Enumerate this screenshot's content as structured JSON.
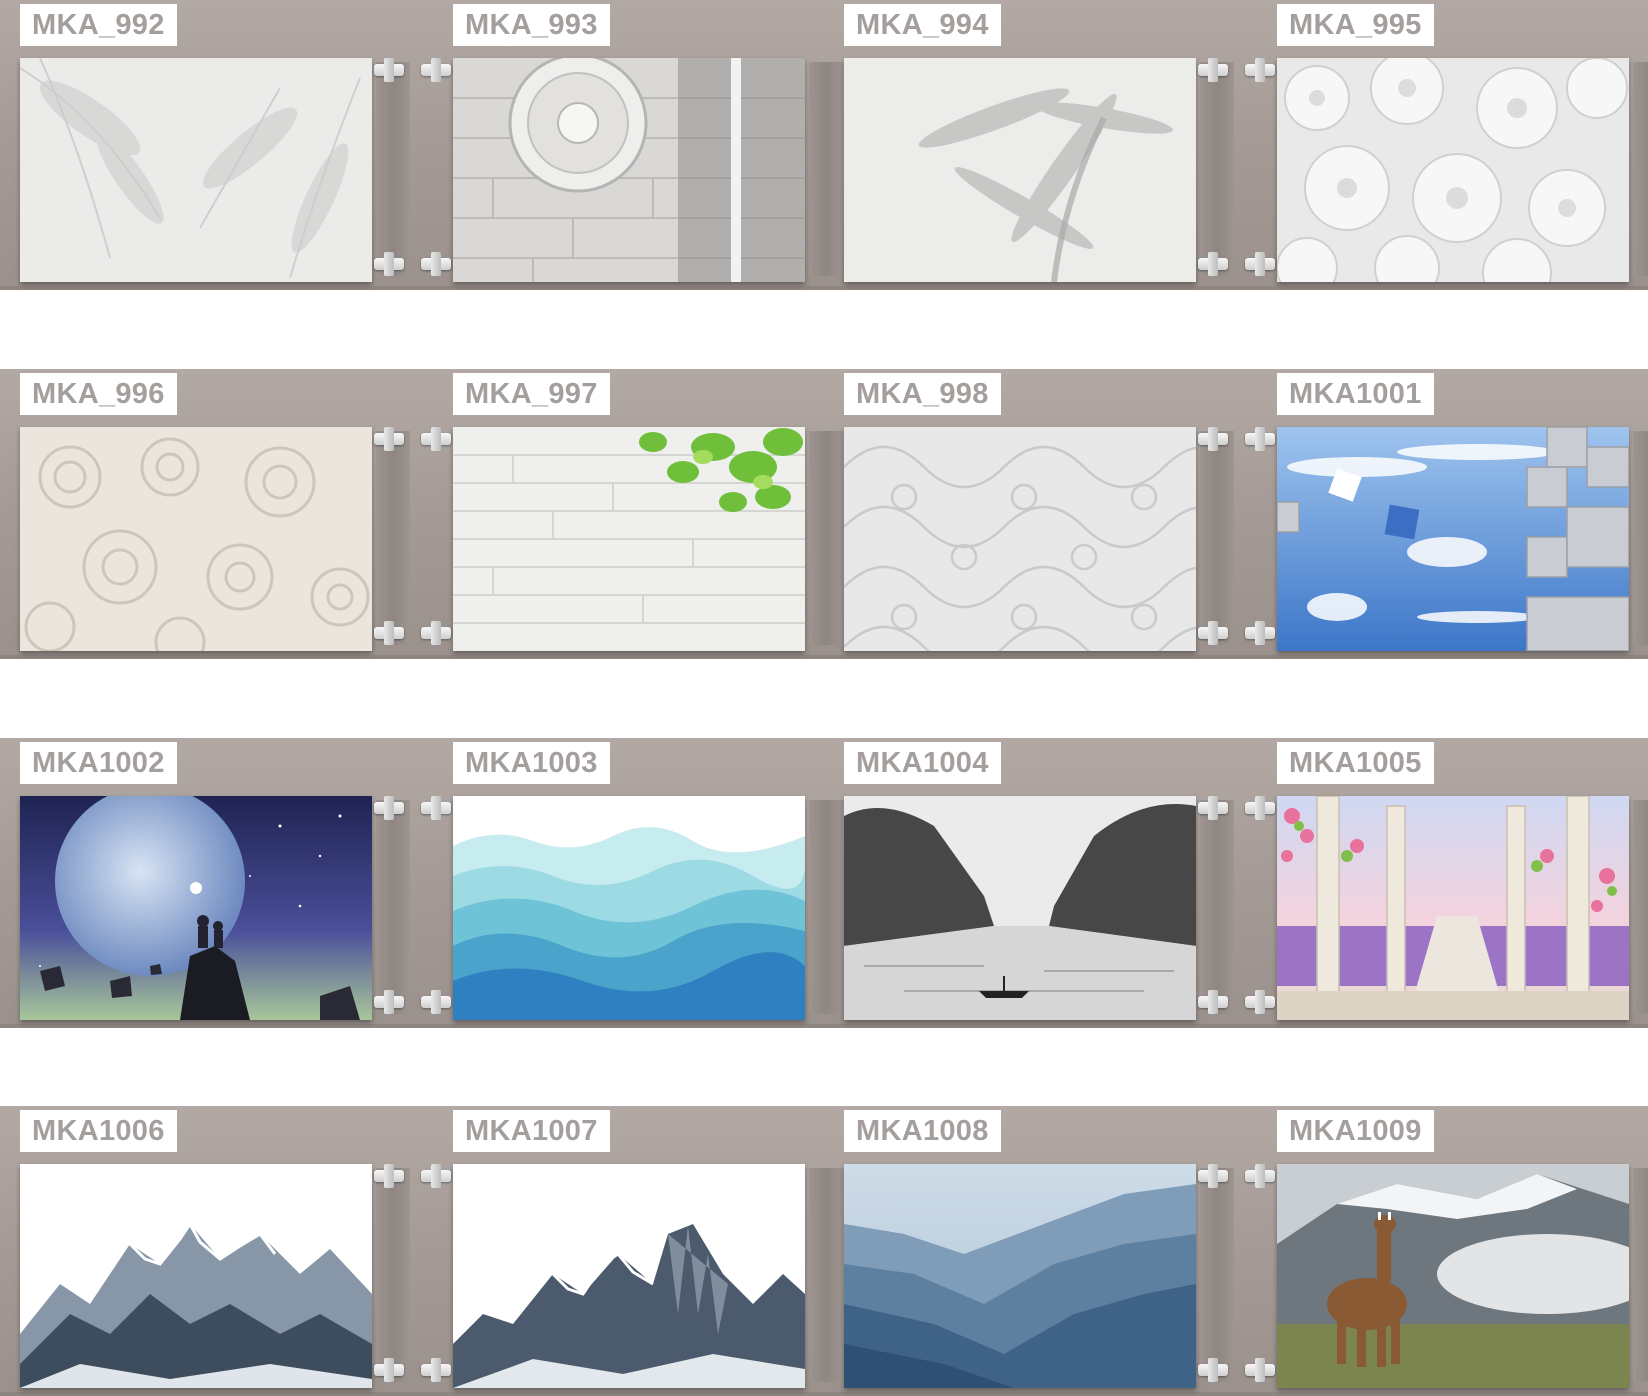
{
  "rows": [
    [
      "MKA_992",
      "MKA_993",
      "MKA_994",
      "MKA_995"
    ],
    [
      "MKA_996",
      "MKA_997",
      "MKA_998",
      "MKA1001"
    ],
    [
      "MKA1002",
      "MKA1003",
      "MKA1004",
      "MKA1005"
    ],
    [
      "MKA1006",
      "MKA1007",
      "MKA1008",
      "MKA1009"
    ]
  ],
  "colors": {
    "wall": "#a69c97",
    "label_background": "#ffffff",
    "label_text": "#a49f9d"
  }
}
